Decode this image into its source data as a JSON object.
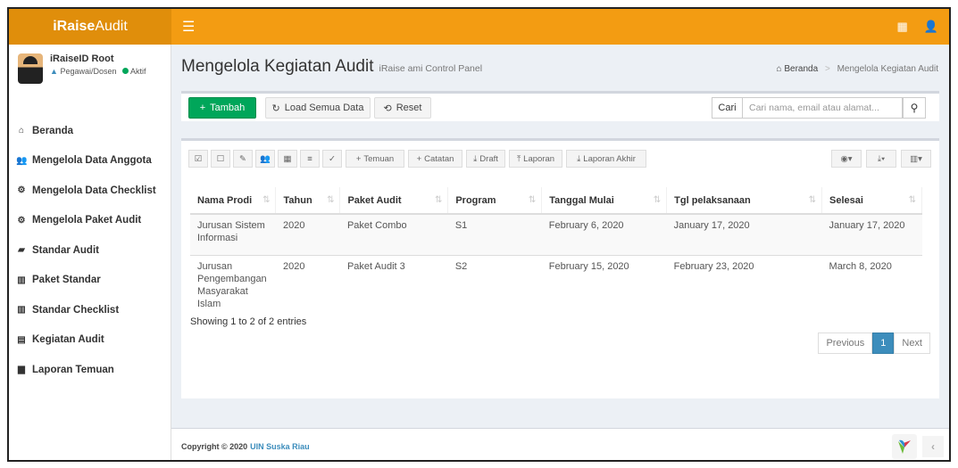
{
  "app": {
    "logo_bold": "iRaise",
    "logo_rest": "Audit"
  },
  "user": {
    "name": "iRaiseID Root",
    "role": "Pegawai/Dosen",
    "status": "Aktif"
  },
  "menu": [
    {
      "icon": "home-icon",
      "glyph": "⌂",
      "label": "Beranda"
    },
    {
      "icon": "users-icon",
      "glyph": "👥",
      "label": "Mengelola Data Anggota"
    },
    {
      "icon": "cogs-icon",
      "glyph": "⚙",
      "label": "Mengelola Data Checklist"
    },
    {
      "icon": "cogs-icon",
      "glyph": "⚙",
      "label": "Mengelola Paket Audit"
    },
    {
      "icon": "book-icon",
      "glyph": "▰",
      "label": "Standar Audit"
    },
    {
      "icon": "bar-chart-icon",
      "glyph": "▥",
      "label": "Paket Standar"
    },
    {
      "icon": "bar-chart-icon",
      "glyph": "▥",
      "label": "Standar Checklist"
    },
    {
      "icon": "id-card-icon",
      "glyph": "▤",
      "label": "Kegiatan Audit"
    },
    {
      "icon": "folder-icon",
      "glyph": "▆",
      "label": "Laporan Temuan"
    }
  ],
  "page": {
    "title": "Mengelola Kegiatan Audit",
    "subtitle": "iRaise ami Control Panel"
  },
  "breadcrumb": {
    "home": "Beranda",
    "current": "Mengelola Kegiatan Audit"
  },
  "toolbar": {
    "add": "Tambah",
    "load_all": "Load Semua Data",
    "reset": "Reset",
    "search_label": "Cari",
    "search_placeholder": "Cari nama, email atau alamat..."
  },
  "grid_toolbar": {
    "temuan": "Temuan",
    "catatan": "Catatan",
    "draft": "Draft",
    "laporan": "Laporan",
    "laporan_akhir": "Laporan Akhir"
  },
  "table": {
    "columns": [
      "Nama Prodi",
      "Tahun",
      "Paket Audit",
      "Program",
      "Tanggal Mulai",
      "Tgl pelaksanaan",
      "Selesai"
    ],
    "rows": [
      [
        "Jurusan Sistem Informasi",
        "2020",
        "Paket Combo",
        "S1",
        "February 6, 2020",
        "January 17, 2020",
        "January 17, 2020"
      ],
      [
        "Jurusan Pengembangan Masyarakat Islam",
        "2020",
        "Paket Audit 3",
        "S2",
        "February 15, 2020",
        "February 23, 2020",
        "March 8, 2020"
      ]
    ],
    "summary": "Showing 1 to 2 of 2 entries"
  },
  "pager": {
    "prev": "Previous",
    "page": "1",
    "next": "Next"
  },
  "footer": {
    "copyright": "Copyright © 2020",
    "org": "UIN Suska Riau"
  }
}
